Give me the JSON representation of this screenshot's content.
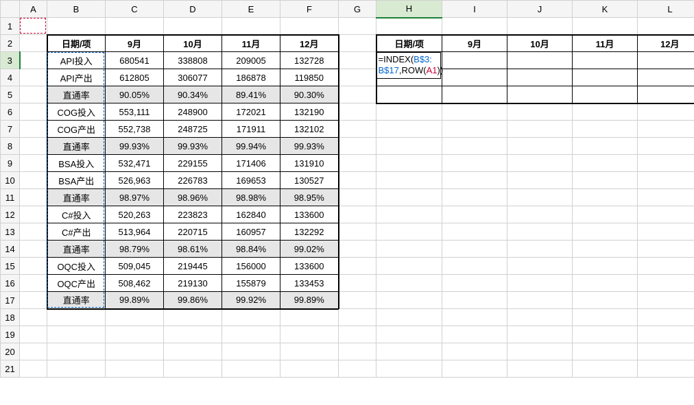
{
  "columns": [
    "A",
    "B",
    "C",
    "D",
    "E",
    "F",
    "G",
    "H",
    "I",
    "J",
    "K",
    "L"
  ],
  "rows": [
    "1",
    "2",
    "3",
    "4",
    "5",
    "6",
    "7",
    "8",
    "9",
    "10",
    "11",
    "12",
    "13",
    "14",
    "15",
    "16",
    "17",
    "18",
    "19",
    "20",
    "21"
  ],
  "table1": {
    "header": [
      "日期/项",
      "9月",
      "10月",
      "11月",
      "12月"
    ],
    "rows": [
      {
        "label": "API投入",
        "vals": [
          "680541",
          "338808",
          "209005",
          "132728"
        ],
        "shade": false
      },
      {
        "label": "API产出",
        "vals": [
          "612805",
          "306077",
          "186878",
          "119850"
        ],
        "shade": false
      },
      {
        "label": "直通率",
        "vals": [
          "90.05%",
          "90.34%",
          "89.41%",
          "90.30%"
        ],
        "shade": true
      },
      {
        "label": "COG投入",
        "vals": [
          "553,111",
          "248900",
          "172021",
          "132190"
        ],
        "shade": false
      },
      {
        "label": "COG产出",
        "vals": [
          "552,738",
          "248725",
          "171911",
          "132102"
        ],
        "shade": false
      },
      {
        "label": "直通率",
        "vals": [
          "99.93%",
          "99.93%",
          "99.94%",
          "99.93%"
        ],
        "shade": true
      },
      {
        "label": "BSA投入",
        "vals": [
          "532,471",
          "229155",
          "171406",
          "131910"
        ],
        "shade": false
      },
      {
        "label": "BSA产出",
        "vals": [
          "526,963",
          "226783",
          "169653",
          "130527"
        ],
        "shade": false
      },
      {
        "label": "直通率",
        "vals": [
          "98.97%",
          "98.96%",
          "98.98%",
          "98.95%"
        ],
        "shade": true
      },
      {
        "label": "C#投入",
        "vals": [
          "520,263",
          "223823",
          "162840",
          "133600"
        ],
        "shade": false
      },
      {
        "label": "C#产出",
        "vals": [
          "513,964",
          "220715",
          "160957",
          "132292"
        ],
        "shade": false
      },
      {
        "label": "直通率",
        "vals": [
          "98.79%",
          "98.61%",
          "98.84%",
          "99.02%"
        ],
        "shade": true
      },
      {
        "label": "OQC投入",
        "vals": [
          "509,045",
          "219445",
          "156000",
          "133600"
        ],
        "shade": false
      },
      {
        "label": "OQC产出",
        "vals": [
          "508,462",
          "219130",
          "155879",
          "133453"
        ],
        "shade": false
      },
      {
        "label": "直通率",
        "vals": [
          "99.89%",
          "99.86%",
          "99.92%",
          "99.89%"
        ],
        "shade": true
      }
    ]
  },
  "table2": {
    "header": [
      "日期/项",
      "9月",
      "10月",
      "11月",
      "12月"
    ],
    "rows": 3
  },
  "formula": {
    "parts": [
      "=INDEX(",
      "B$3:B$17",
      ",ROW(",
      "A1",
      "))"
    ],
    "line1_html": "=INDEX(<ref1>B$3:</ref1>",
    "line2_html": "<ref1>B$17</ref1>,ROW(<ref2>A1</ref2>))"
  },
  "active_cell": "H3"
}
